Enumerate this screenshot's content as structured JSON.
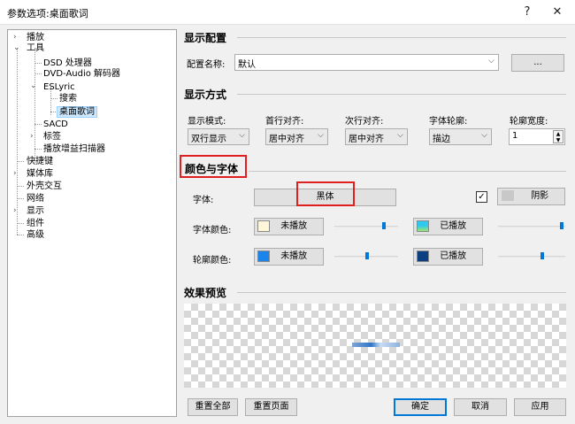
{
  "window": {
    "title": "参数选项:桌面歌词",
    "help": "?",
    "close": "✕"
  },
  "tree": {
    "play": "播放",
    "tools": "工具",
    "dsd": "DSD 处理器",
    "dvd": "DVD-Audio 解码器",
    "eslyric": "ESLyric",
    "search": "搜索",
    "desktop_lyric": "桌面歌词",
    "sacd": "SACD",
    "tags": "标签",
    "replaygain": "播放增益扫描器",
    "shortcuts": "快捷键",
    "media": "媒体库",
    "shell": "外壳交互",
    "network": "网络",
    "display": "显示",
    "components": "组件",
    "advanced": "高级"
  },
  "display_config": {
    "title": "显示配置",
    "name_label": "配置名称:",
    "name_value": "默认",
    "more_btn": "..."
  },
  "display_mode": {
    "title": "显示方式",
    "mode_label": "显示模式:",
    "mode_value": "双行显示",
    "first_label": "首行对齐:",
    "first_value": "居中对齐",
    "second_label": "次行对齐:",
    "second_value": "居中对齐",
    "outline_label": "字体轮廓:",
    "outline_value": "描边",
    "width_label": "轮廓宽度:",
    "width_value": "1"
  },
  "color_font": {
    "title": "颜色与字体",
    "font_label": "字体:",
    "font_value": "黑体",
    "shadow_label": "阴影",
    "font_color_label": "字体颜色:",
    "unplayed": "未播放",
    "played": "已播放",
    "outline_color_label": "轮廓颜色:",
    "colors": {
      "font_unplayed": "#fdf6d8",
      "font_played": "#2ec8f0",
      "outline_unplayed": "#1a84ea",
      "outline_played": "#0b3f82"
    }
  },
  "preview": {
    "title": "效果预览"
  },
  "buttons": {
    "reset_all": "重置全部",
    "reset_page": "重置页面",
    "ok": "确定",
    "cancel": "取消",
    "apply": "应用"
  }
}
